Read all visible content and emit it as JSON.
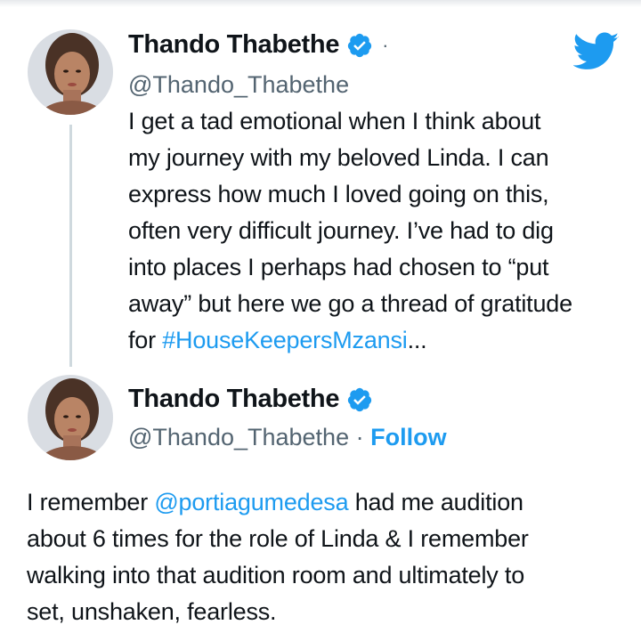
{
  "tweet1": {
    "display_name": "Thando Thabethe",
    "handle": "@Thando_Thabethe",
    "separator": "·",
    "lines": [
      "I get a tad emotional when I think about",
      "my journey with my beloved Linda. I can",
      "express how much I loved going on this,",
      "often very difficult journey. I’ve had to dig",
      "into places I perhaps had chosen to “put",
      "away” but here we go a thread of gratitude"
    ],
    "last_line_prefix": "for ",
    "hashtag": "#HouseKeepersMzansi",
    "ellipsis": "..."
  },
  "tweet2": {
    "display_name": "Thando Thabethe",
    "handle": "@Thando_Thabethe",
    "separator": " · ",
    "follow_label": "Follow",
    "first_line_prefix": "I remember ",
    "mention": "@portiagumedesa",
    "first_line_suffix": " had me audition",
    "lines": [
      "about 6 times for the role of Linda & I remember",
      "walking into that audition room and ultimately to",
      "set, unshaken, fearless."
    ]
  },
  "icons": {
    "logo": "twitter-bird-icon",
    "verified": "verified-badge-icon"
  },
  "colors": {
    "accent": "#1d9bf0",
    "text": "#0f1419",
    "secondary": "#536471",
    "thread_line": "#cfd9de"
  }
}
